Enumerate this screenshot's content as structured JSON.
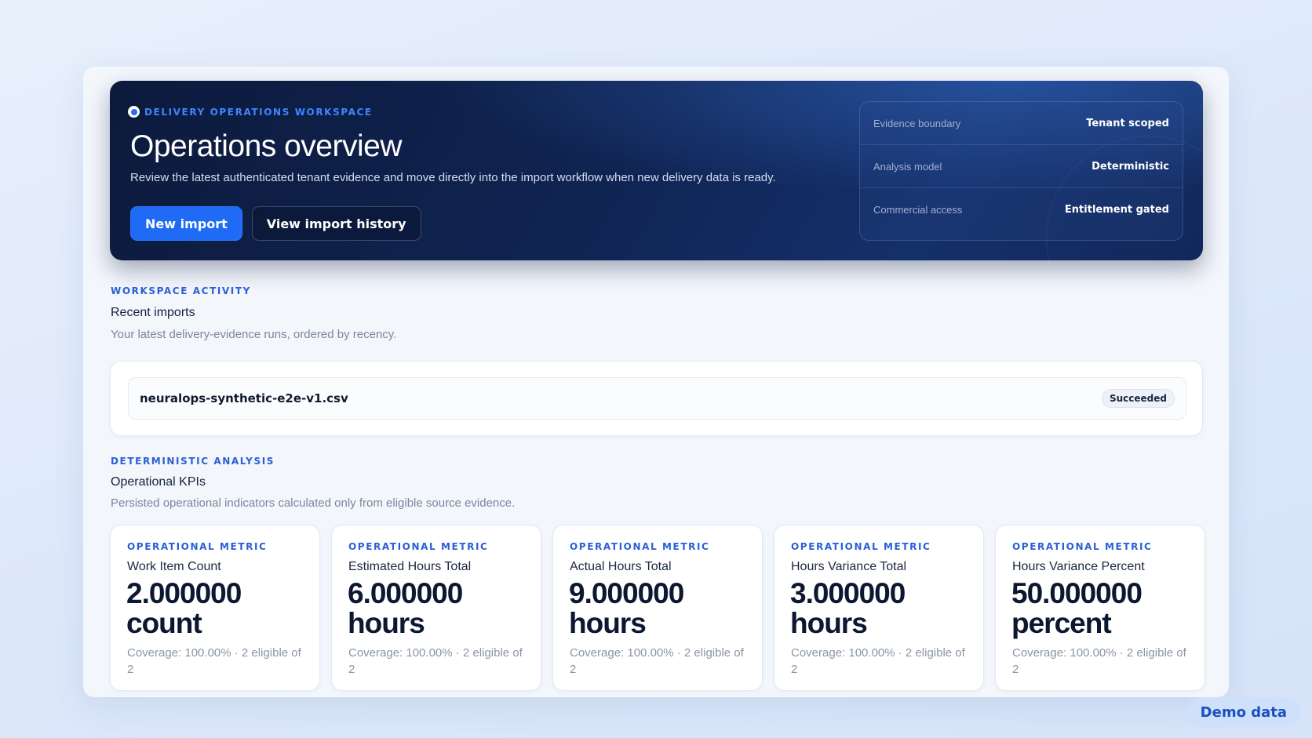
{
  "hero": {
    "eyebrow": "DELIVERY OPERATIONS WORKSPACE",
    "title": "Operations overview",
    "description": "Review the latest authenticated tenant evidence and move directly into the import workflow when new delivery data is ready.",
    "primary_button": "New import",
    "secondary_button": "View import history",
    "facts": [
      {
        "label": "Evidence boundary",
        "value": "Tenant scoped"
      },
      {
        "label": "Analysis model",
        "value": "Deterministic"
      },
      {
        "label": "Commercial access",
        "value": "Entitlement gated"
      }
    ]
  },
  "activity": {
    "eyebrow": "WORKSPACE ACTIVITY",
    "title": "Recent imports",
    "description": "Your latest delivery-evidence runs, ordered by recency.",
    "imports": [
      {
        "file": "neuralops-synthetic-e2e-v1.csv",
        "status": "Succeeded"
      }
    ]
  },
  "analysis": {
    "eyebrow": "DETERMINISTIC ANALYSIS",
    "title": "Operational KPIs",
    "description": "Persisted operational indicators calculated only from eligible source evidence.",
    "kpis": [
      {
        "eyebrow": "OPERATIONAL METRIC",
        "name": "Work Item Count",
        "value": "2.000000 count",
        "coverage": "Coverage: 100.00% · 2 eligible of 2"
      },
      {
        "eyebrow": "OPERATIONAL METRIC",
        "name": "Estimated Hours Total",
        "value": "6.000000 hours",
        "coverage": "Coverage: 100.00% · 2 eligible of 2"
      },
      {
        "eyebrow": "OPERATIONAL METRIC",
        "name": "Actual Hours Total",
        "value": "9.000000 hours",
        "coverage": "Coverage: 100.00% · 2 eligible of 2"
      },
      {
        "eyebrow": "OPERATIONAL METRIC",
        "name": "Hours Variance Total",
        "value": "3.000000 hours",
        "coverage": "Coverage: 100.00% · 2 eligible of 2"
      },
      {
        "eyebrow": "OPERATIONAL METRIC",
        "name": "Hours Variance Percent",
        "value": "50.000000 percent",
        "coverage": "Coverage: 100.00% · 2 eligible of 2"
      }
    ]
  },
  "demo_badge": "Demo data",
  "colors": {
    "accent": "#1f6bf5",
    "hero_bg": "#0c1a3c",
    "eyebrow_blue": "#2a5fd6"
  }
}
